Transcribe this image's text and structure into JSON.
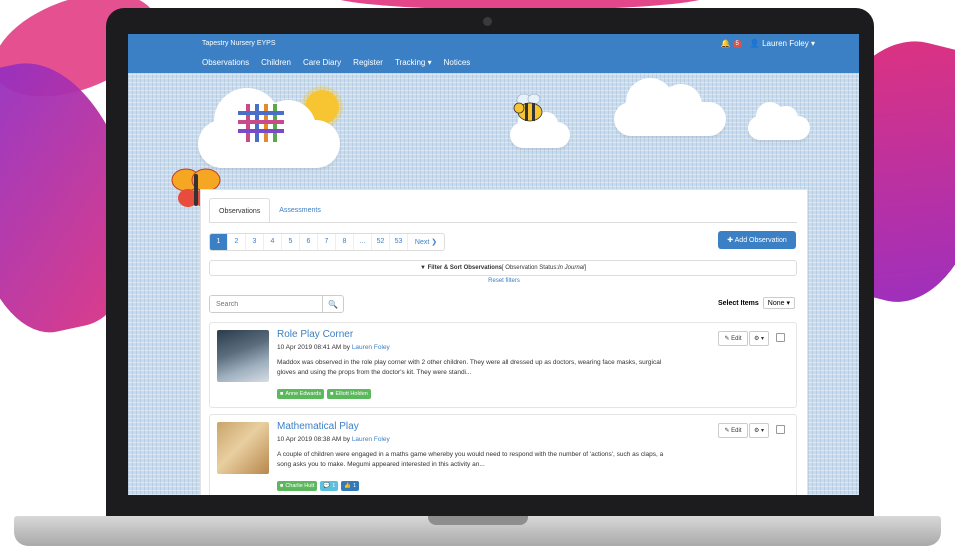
{
  "navbar": {
    "brand": "Tapestry Nursery EYPS",
    "items": [
      "Observations",
      "Children",
      "Care Diary",
      "Register",
      "Tracking ▾",
      "Notices"
    ],
    "notification_count": "5",
    "user": "Lauren Foley ▾"
  },
  "tabs": [
    "Observations",
    "Assessments"
  ],
  "pagination": {
    "pages": [
      "1",
      "2",
      "3",
      "4",
      "5",
      "6",
      "7",
      "8",
      "...",
      "52",
      "53"
    ],
    "next": "Next ❯",
    "active": "1"
  },
  "add_button": "✚ Add Observation",
  "filter": {
    "title": "▼ Filter & Sort Observations",
    "status_prefix": " [ Observation Status: ",
    "status_value": "In Journal",
    "status_suffix": " ]",
    "reset": "Reset filters"
  },
  "search": {
    "placeholder": "Search"
  },
  "select_items": {
    "label": "Select Items",
    "value": "None ▾"
  },
  "observations": [
    {
      "title": "Role Play Corner",
      "date": "10 Apr 2019 08:41 AM by ",
      "author": "Lauren Foley",
      "text": "Maddox was observed in the role play corner with 2 other children. They were all dressed up as doctors, wearing face masks, surgical gloves and using the props from the doctor's kit. They were standi...",
      "tags": [
        "Anne Edwards",
        "Elliott Holden"
      ]
    },
    {
      "title": "Mathematical Play",
      "date": "10 Apr 2019 08:38 AM by ",
      "author": "Lauren Foley",
      "text": "A couple of children were engaged in a maths game whereby you would need to respond with the number of 'actions', such as claps, a song asks you to make. Megumi appeared interested in this activity an...",
      "tags": [
        "Charlie Hutt",
        "1",
        "1"
      ]
    }
  ],
  "edit_label": "✎ Edit",
  "gear_label": "⚙ ▾",
  "colors": {
    "primary": "#3b7fc4",
    "tag_green": "#5cb85c",
    "tag_blue": "#5bc0de",
    "accent_pink": "#e0337d"
  }
}
